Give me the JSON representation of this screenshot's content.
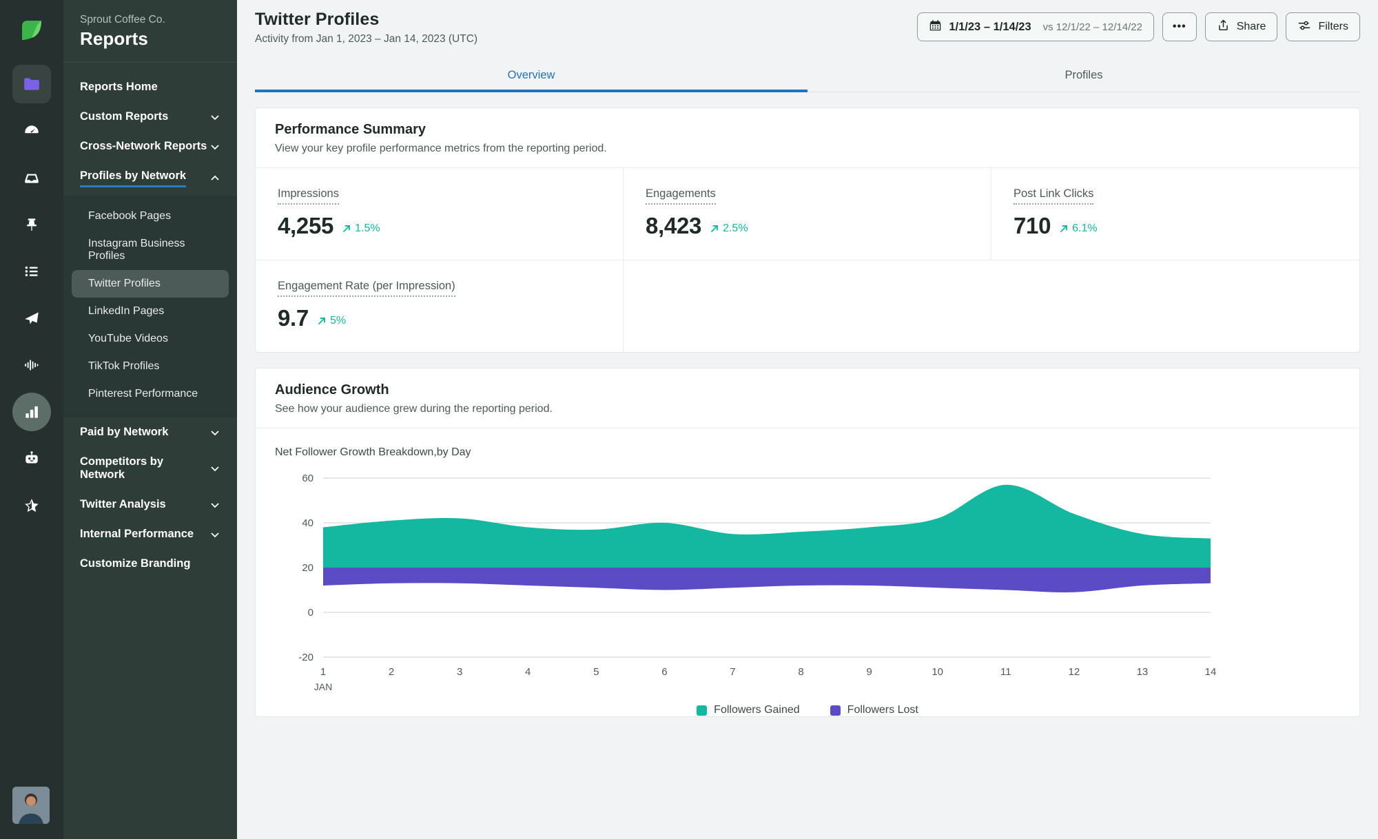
{
  "rail": {
    "logo": "sprout-leaf-logo",
    "icons": [
      {
        "name": "folder-icon",
        "state": "boxed"
      },
      {
        "name": "dashboard-gauge-icon",
        "state": "plain"
      },
      {
        "name": "inbox-icon",
        "state": "plain"
      },
      {
        "name": "pin-icon",
        "state": "plain"
      },
      {
        "name": "list-icon",
        "state": "plain"
      },
      {
        "name": "send-paper-plane-icon",
        "state": "plain"
      },
      {
        "name": "audio-waveform-icon",
        "state": "plain"
      },
      {
        "name": "bar-chart-icon",
        "state": "circled"
      },
      {
        "name": "bot-icon",
        "state": "plain"
      },
      {
        "name": "star-half-icon",
        "state": "plain"
      }
    ]
  },
  "sidebar": {
    "org": "Sprout Coffee Co.",
    "title": "Reports",
    "items": [
      {
        "label": "Reports Home",
        "expandable": false,
        "active": false
      },
      {
        "label": "Custom Reports",
        "expandable": true,
        "chevron": "down",
        "active": false
      },
      {
        "label": "Cross-Network Reports",
        "expandable": true,
        "chevron": "down",
        "active": false
      },
      {
        "label": "Profiles by Network",
        "expandable": true,
        "chevron": "up",
        "active": true
      }
    ],
    "sub_items": [
      {
        "label": "Facebook Pages",
        "selected": false
      },
      {
        "label": "Instagram Business Profiles",
        "selected": false
      },
      {
        "label": "Twitter Profiles",
        "selected": true
      },
      {
        "label": "LinkedIn Pages",
        "selected": false
      },
      {
        "label": "YouTube Videos",
        "selected": false
      },
      {
        "label": "TikTok Profiles",
        "selected": false
      },
      {
        "label": "Pinterest Performance",
        "selected": false
      }
    ],
    "items_after": [
      {
        "label": "Paid by Network",
        "expandable": true,
        "chevron": "down"
      },
      {
        "label": "Competitors by Network",
        "expandable": true,
        "chevron": "down"
      },
      {
        "label": "Twitter Analysis",
        "expandable": true,
        "chevron": "down"
      },
      {
        "label": "Internal Performance",
        "expandable": true,
        "chevron": "down"
      },
      {
        "label": "Customize Branding",
        "expandable": false
      }
    ]
  },
  "header": {
    "title": "Twitter Profiles",
    "subtitle": "Activity from Jan 1, 2023 – Jan 14, 2023 (UTC)",
    "date_range": "1/1/23 – 1/14/23",
    "date_compare": "vs 12/1/22 – 12/14/22",
    "more_label": "•••",
    "share_label": "Share",
    "filters_label": "Filters"
  },
  "tabs": [
    {
      "label": "Overview",
      "active": true
    },
    {
      "label": "Profiles",
      "active": false
    }
  ],
  "performance": {
    "title": "Performance Summary",
    "description": "View your key profile performance metrics from the reporting period.",
    "metrics": [
      {
        "label": "Impressions",
        "value": "4,255",
        "delta": "1.5%",
        "direction": "up"
      },
      {
        "label": "Engagements",
        "value": "8,423",
        "delta": "2.5%",
        "direction": "up"
      },
      {
        "label": "Post Link Clicks",
        "value": "710",
        "delta": "6.1%",
        "direction": "up"
      },
      {
        "label": "Engagement Rate (per Impression)",
        "value": "9.7",
        "delta": "5%",
        "direction": "up"
      }
    ]
  },
  "audience": {
    "title": "Audience Growth",
    "description": "See how your audience grew during the reporting period."
  },
  "colors": {
    "accent_blue": "#1f74bd",
    "teal": "#14b8a0",
    "purple": "#5b4bc4",
    "delta_green": "#14b8a0"
  },
  "chart_data": {
    "type": "area",
    "title": "Net Follower Growth Breakdown,by Day",
    "xlabel": "JAN",
    "ylabel": "",
    "x": [
      1,
      2,
      3,
      4,
      5,
      6,
      7,
      8,
      9,
      10,
      11,
      12,
      13,
      14
    ],
    "xtick_labels": [
      "1",
      "2",
      "3",
      "4",
      "5",
      "6",
      "7",
      "8",
      "9",
      "10",
      "11",
      "12",
      "13",
      "14"
    ],
    "ytick_labels": [
      "60",
      "40",
      "20",
      "0",
      "-20"
    ],
    "ylim": [
      -20,
      60
    ],
    "grid": true,
    "legend_position": "bottom",
    "baseline": 20,
    "series": [
      {
        "name": "Followers Gained",
        "color": "#14b8a0",
        "values": [
          38,
          41,
          42,
          38,
          37,
          40,
          35,
          36,
          38,
          42,
          57,
          44,
          35,
          33
        ]
      },
      {
        "name": "Followers Lost",
        "color": "#5b4bc4",
        "values": [
          16,
          17,
          17,
          16,
          15,
          14,
          15,
          16,
          16,
          15,
          14,
          13,
          16,
          17
        ]
      }
    ]
  }
}
